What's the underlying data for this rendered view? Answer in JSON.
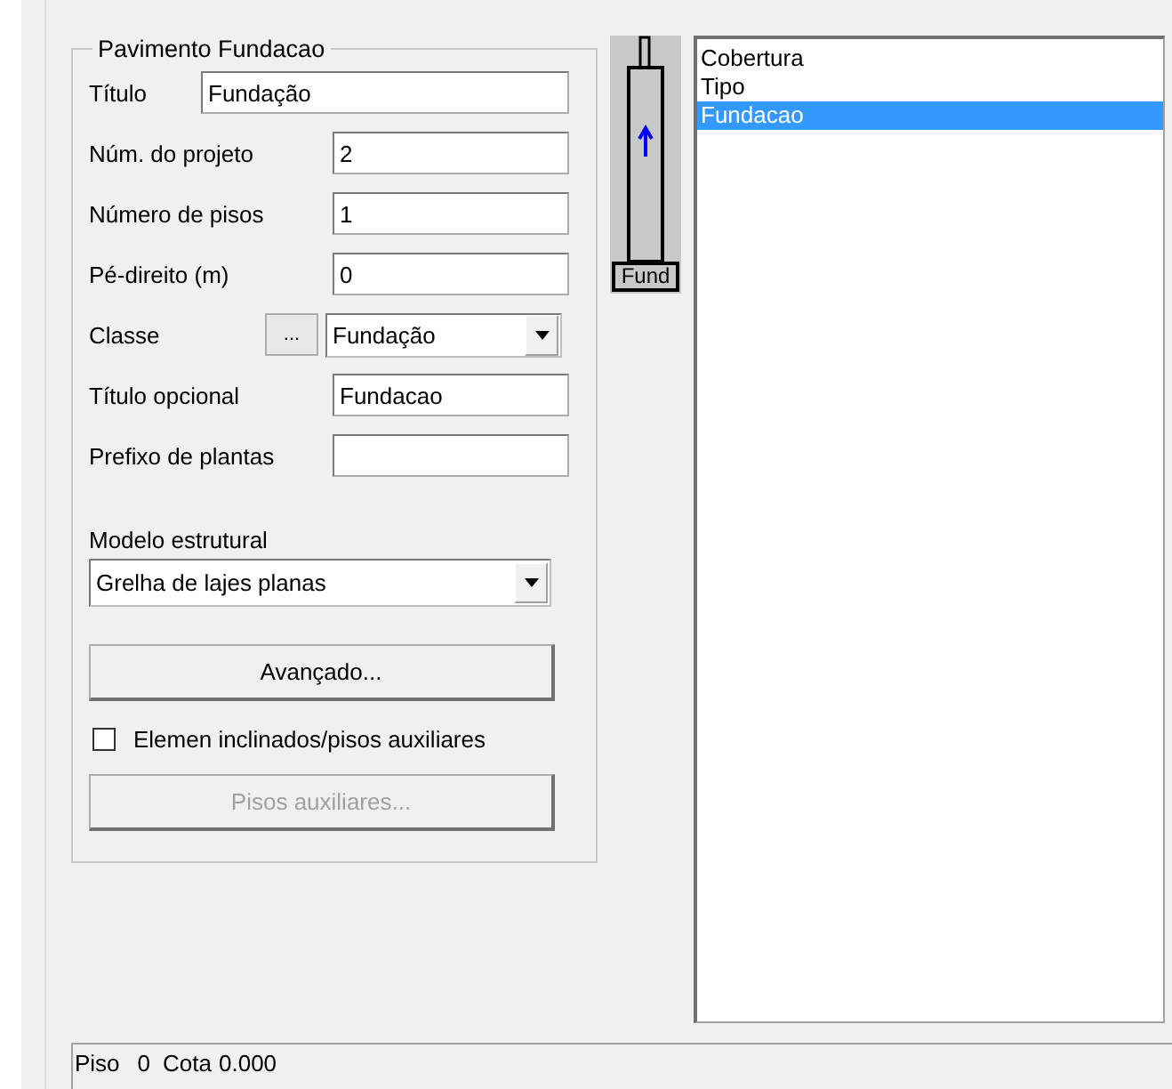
{
  "group": {
    "title": "Pavimento Fundacao",
    "fields": [
      {
        "kind": "wide",
        "label": "Título",
        "value": "Fundação"
      },
      {
        "kind": "text",
        "label": "Núm. do projeto",
        "value": "2"
      },
      {
        "kind": "text",
        "label": "Número de pisos",
        "value": "1"
      },
      {
        "kind": "text",
        "label": "Pé-direito (m)",
        "value": "0"
      },
      {
        "kind": "select",
        "label": "Classe",
        "button": "...",
        "value": "Fundação"
      },
      {
        "kind": "text",
        "label": "Título opcional",
        "value": "Fundacao"
      },
      {
        "kind": "text",
        "label": "Prefixo de plantas"
      }
    ],
    "model": {
      "label": "Modelo estrutural",
      "value": "Grelha de lajes planas"
    },
    "advanced_button": {
      "label": "Avançado...",
      "disabled": false
    },
    "checkbox": {
      "label": "Elemen inclinados/pisos auxiliares",
      "checked": false
    },
    "aux_button": {
      "label": "Pisos auxiliares...",
      "disabled": true
    }
  },
  "building": {
    "label": "Fund"
  },
  "floors": [
    {
      "label": "Cobertura",
      "selected": false
    },
    {
      "label": "Tipo",
      "selected": false
    },
    {
      "label": "Fundacao",
      "selected": true
    }
  ],
  "status_bar": {
    "floor_label": "Piso",
    "floor": "0",
    "elevation_label": "Cota",
    "elevation": "0.000"
  }
}
